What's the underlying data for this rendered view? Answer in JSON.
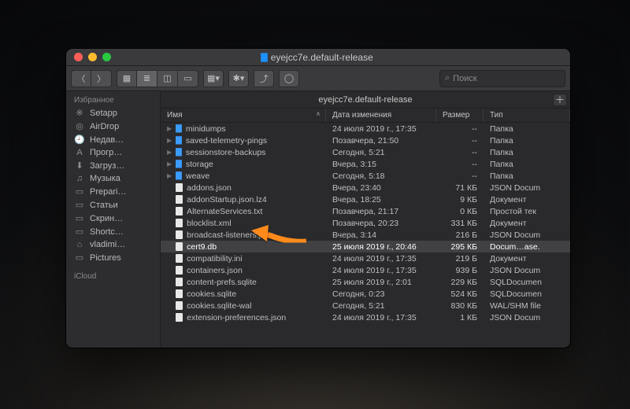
{
  "window": {
    "title": "eyejcc7e.default-release",
    "pathbar": "eyejcc7e.default-release"
  },
  "search": {
    "placeholder": "Поиск"
  },
  "sidebar": {
    "section_fav": "Избранное",
    "section_icloud": "iCloud",
    "items": [
      {
        "icon": "※",
        "label": "Setapp"
      },
      {
        "icon": "◎",
        "label": "AirDrop"
      },
      {
        "icon": "🕘",
        "label": "Недав…"
      },
      {
        "icon": "A",
        "label": "Прогр…"
      },
      {
        "icon": "⬇",
        "label": "Загруз…"
      },
      {
        "icon": "♫",
        "label": "Музыка"
      },
      {
        "icon": "▭",
        "label": "Prepari…"
      },
      {
        "icon": "▭",
        "label": "Статьи"
      },
      {
        "icon": "▭",
        "label": "Скрин…"
      },
      {
        "icon": "▭",
        "label": "Shortc…"
      },
      {
        "icon": "⌂",
        "label": "vladimi…"
      },
      {
        "icon": "▭",
        "label": "Pictures"
      }
    ]
  },
  "columns": {
    "name": "Имя",
    "date": "Дата изменения",
    "size": "Размер",
    "type": "Тип"
  },
  "rows": [
    {
      "folder": true,
      "name": "minidumps",
      "date": "24 июля 2019 г., 17:35",
      "size": "--",
      "type": "Папка"
    },
    {
      "folder": true,
      "name": "saved-telemetry-pings",
      "date": "Позавчера, 21:50",
      "size": "--",
      "type": "Папка"
    },
    {
      "folder": true,
      "name": "sessionstore-backups",
      "date": "Сегодня, 5:21",
      "size": "--",
      "type": "Папка"
    },
    {
      "folder": true,
      "name": "storage",
      "date": "Вчера, 3:15",
      "size": "--",
      "type": "Папка"
    },
    {
      "folder": true,
      "name": "weave",
      "date": "Сегодня, 5:18",
      "size": "--",
      "type": "Папка"
    },
    {
      "folder": false,
      "name": "addons.json",
      "date": "Вчера, 23:40",
      "size": "71 КБ",
      "type": "JSON Docum"
    },
    {
      "folder": false,
      "name": "addonStartup.json.lz4",
      "date": "Вчера, 18:25",
      "size": "9 КБ",
      "type": "Документ"
    },
    {
      "folder": false,
      "name": "AlternateServices.txt",
      "date": "Позавчера, 21:17",
      "size": "0 КБ",
      "type": "Простой тек"
    },
    {
      "folder": false,
      "name": "blocklist.xml",
      "date": "Позавчера, 20:23",
      "size": "331 КБ",
      "type": "Документ"
    },
    {
      "folder": false,
      "name": "broadcast-listeners.json",
      "date": "Вчера, 3:14",
      "size": "216 Б",
      "type": "JSON Docum"
    },
    {
      "folder": false,
      "name": "cert9.db",
      "date": "25 июля 2019 г., 20:46",
      "size": "295 КБ",
      "type": "Docum…ase.",
      "sel": true
    },
    {
      "folder": false,
      "name": "compatibility.ini",
      "date": "24 июля 2019 г., 17:35",
      "size": "219 Б",
      "type": "Документ"
    },
    {
      "folder": false,
      "name": "containers.json",
      "date": "24 июля 2019 г., 17:35",
      "size": "939 Б",
      "type": "JSON Docum"
    },
    {
      "folder": false,
      "name": "content-prefs.sqlite",
      "date": "25 июля 2019 г., 2:01",
      "size": "229 КБ",
      "type": "SQLDocumen"
    },
    {
      "folder": false,
      "name": "cookies.sqlite",
      "date": "Сегодня, 0:23",
      "size": "524 КБ",
      "type": "SQLDocumen"
    },
    {
      "folder": false,
      "name": "cookies.sqlite-wal",
      "date": "Сегодня, 5:21",
      "size": "830 КБ",
      "type": "WAL/SHM file"
    },
    {
      "folder": false,
      "name": "extension-preferences.json",
      "date": "24 июля 2019 г., 17:35",
      "size": "1 КБ",
      "type": "JSON Docum"
    }
  ]
}
